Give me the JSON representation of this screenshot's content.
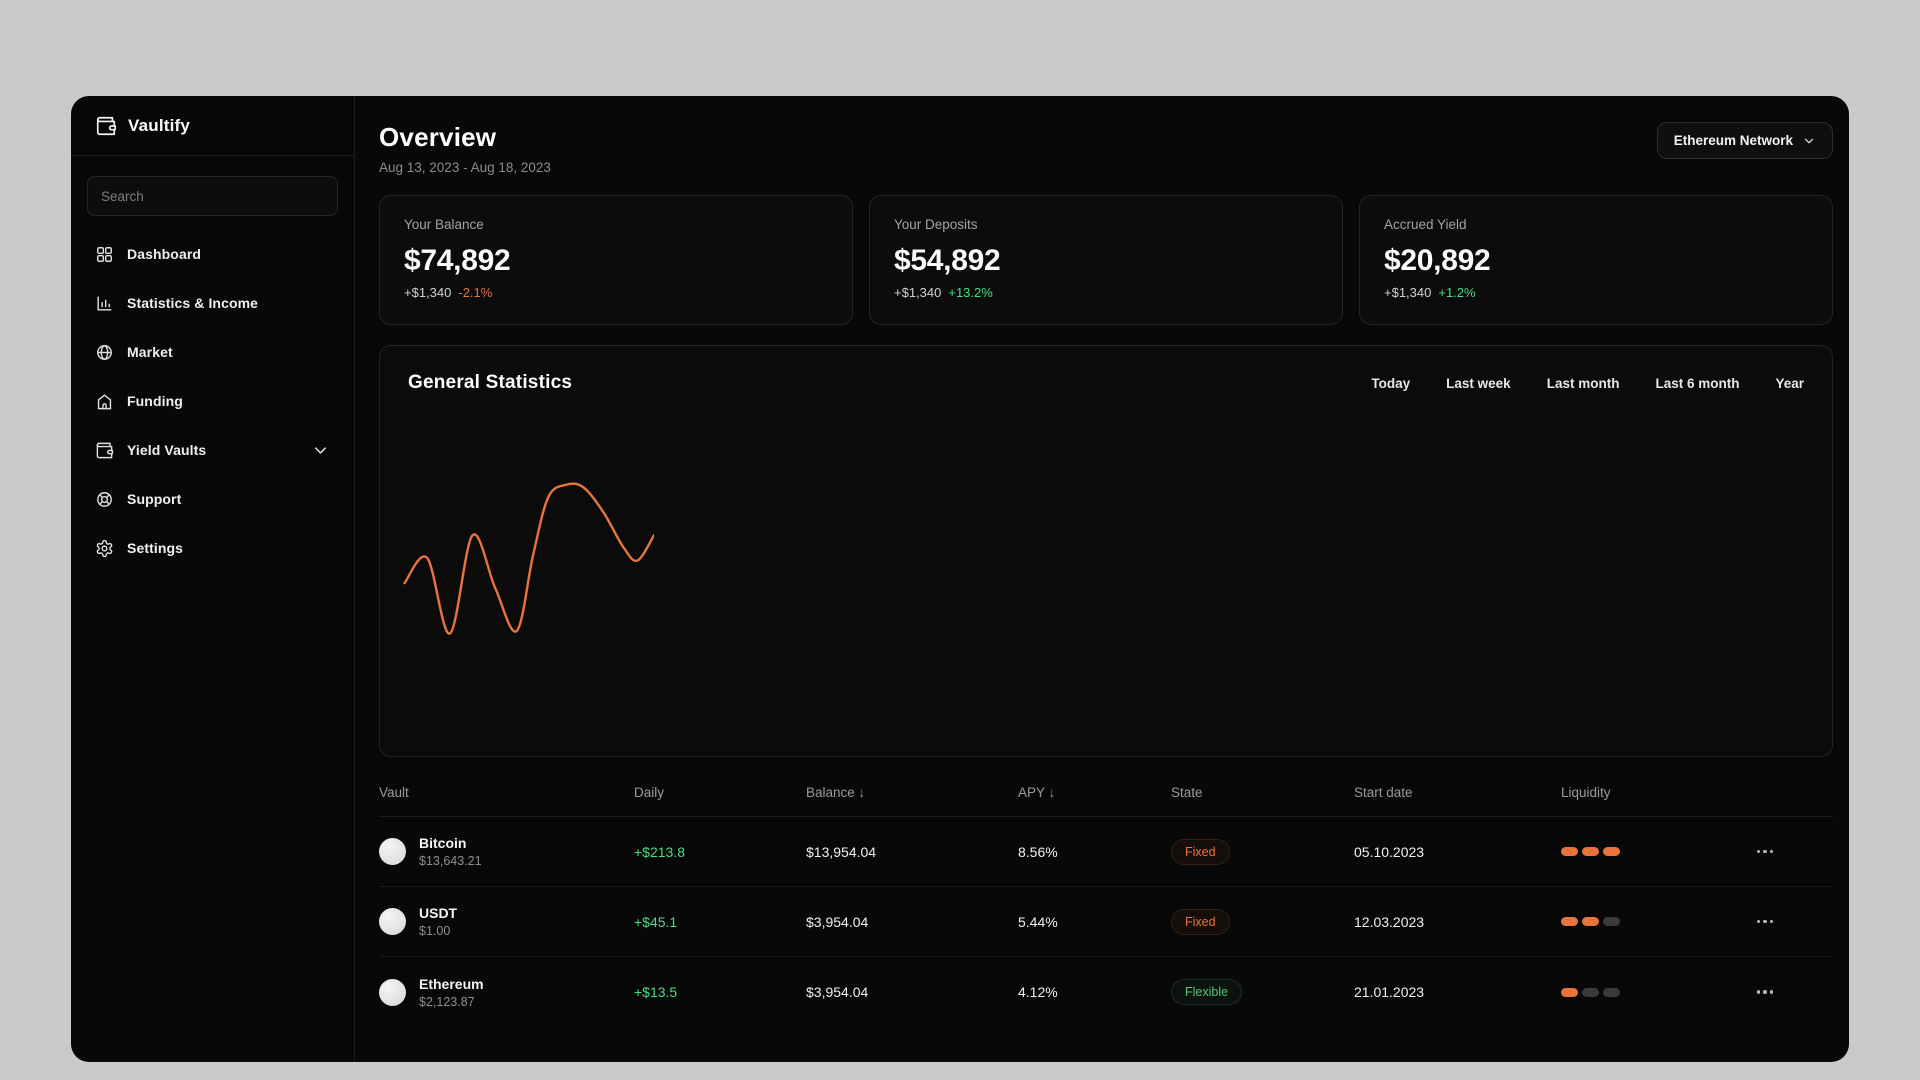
{
  "sidebar": {
    "brand": "Vaultify",
    "search_placeholder": "Search",
    "items": [
      {
        "label": "Dashboard",
        "icon": "dashboard-grid-icon"
      },
      {
        "label": "Statistics & Income",
        "icon": "bar-chart-icon"
      },
      {
        "label": "Market",
        "icon": "globe-icon"
      },
      {
        "label": "Funding",
        "icon": "home-icon"
      },
      {
        "label": "Yield Vaults",
        "icon": "wallet-icon",
        "expandable": true
      },
      {
        "label": "Support",
        "icon": "lifebuoy-icon"
      },
      {
        "label": "Settings",
        "icon": "gear-icon"
      }
    ]
  },
  "header": {
    "title": "Overview",
    "date_range": "Aug 13, 2023 - Aug 18, 2023",
    "network_selector": "Ethereum Network"
  },
  "cards": [
    {
      "title": "Your Balance",
      "value": "$74,892",
      "change_amount": "+$1,340",
      "change_pct": "-2.1%",
      "pct_direction": "down"
    },
    {
      "title": "Your Deposits",
      "value": "$54,892",
      "change_amount": "+$1,340",
      "change_pct": "+13.2%",
      "pct_direction": "up"
    },
    {
      "title": "Accrued Yield",
      "value": "$20,892",
      "change_amount": "+$1,340",
      "change_pct": "+1.2%",
      "pct_direction": "up"
    }
  ],
  "statistics": {
    "title": "General Statistics",
    "filters": [
      "Today",
      "Last week",
      "Last month",
      "Last 6 month",
      "Year"
    ]
  },
  "chart_data": {
    "type": "line",
    "title": "General Statistics",
    "x_axis": "hidden",
    "y_axis": "hidden",
    "grid": false,
    "legend": false,
    "series": [
      {
        "name": "portfolio-value",
        "color": "#e8743b",
        "note": "points are [x_percent_across, relative_height_percent] estimated; no axis labels shown",
        "points": [
          [
            1,
            44
          ],
          [
            10,
            54
          ],
          [
            19,
            24
          ],
          [
            28,
            63
          ],
          [
            37,
            42
          ],
          [
            45.5,
            25
          ],
          [
            52,
            55
          ],
          [
            58,
            78
          ],
          [
            65,
            83
          ],
          [
            72,
            82
          ],
          [
            80,
            72
          ],
          [
            88,
            58
          ],
          [
            93.5,
            53
          ],
          [
            100,
            63
          ]
        ]
      }
    ]
  },
  "table": {
    "columns": [
      "Vault",
      "Daily",
      "Balance ↓",
      "APY ↓",
      "State",
      "Start date",
      "Liquidity"
    ],
    "liquidity_max": 3,
    "rows": [
      {
        "name": "Bitcoin",
        "price": "$13,643.21",
        "daily": "+$213.8",
        "balance": "$13,954.04",
        "apy": "8.56%",
        "state": "Fixed",
        "start_date": "05.10.2023",
        "liquidity": 3
      },
      {
        "name": "USDT",
        "price": "$1.00",
        "daily": "+$45.1",
        "balance": "$3,954.04",
        "apy": "5.44%",
        "state": "Fixed",
        "start_date": "12.03.2023",
        "liquidity": 2
      },
      {
        "name": "Ethereum",
        "price": "$2,123.87",
        "daily": "+$13.5",
        "balance": "$3,954.04",
        "apy": "4.12%",
        "state": "Flexible",
        "start_date": "21.01.2023",
        "liquidity": 1
      }
    ]
  },
  "colors": {
    "accent_orange": "#e8743b",
    "positive_green": "#4ade80",
    "window_bg": "#080808",
    "outer_bg": "#c9c9c9"
  }
}
